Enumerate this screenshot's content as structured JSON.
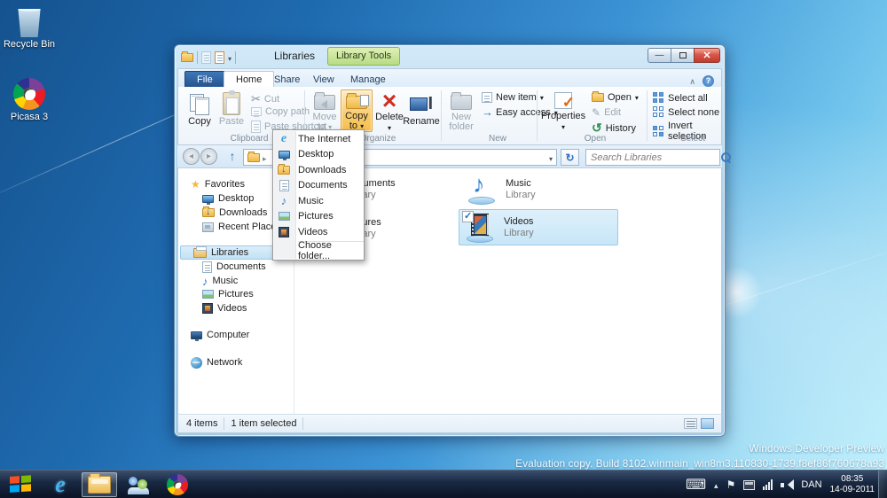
{
  "desktop": {
    "icons": {
      "recycle_bin": "Recycle Bin",
      "picasa": "Picasa 3"
    },
    "watermark_line1": "Windows Developer Preview",
    "watermark_line2": "Evaluation copy. Build 8102.winmain_win8m3.110830-1739.f8ef86f760678a93"
  },
  "window": {
    "title": "Libraries",
    "tools_group": "Library Tools",
    "tabs": {
      "file": "File",
      "home": "Home",
      "share": "Share",
      "view": "View",
      "manage": "Manage"
    }
  },
  "ribbon": {
    "clipboard": {
      "group": "Clipboard",
      "copy": "Copy",
      "paste": "Paste",
      "cut": "Cut",
      "copy_path": "Copy path",
      "paste_shortcut": "Paste shortcut"
    },
    "organize": {
      "group": "Organize",
      "move_line1": "Move",
      "move_line2": "to",
      "copy_line1": "Copy",
      "copy_line2": "to",
      "delete": "Delete",
      "rename": "Rename"
    },
    "new": {
      "group": "New",
      "new_folder_line1": "New",
      "new_folder_line2": "folder",
      "new_item": "New item",
      "easy_access": "Easy access"
    },
    "open": {
      "group": "Open",
      "properties": "Properties",
      "open": "Open",
      "edit": "Edit",
      "history": "History"
    },
    "select": {
      "group": "Select",
      "select_all": "Select all",
      "select_none": "Select none",
      "invert": "Invert selection"
    }
  },
  "address": {
    "search_placeholder": "Search Libraries"
  },
  "menu": {
    "items": [
      "The Internet",
      "Desktop",
      "Downloads",
      "Documents",
      "Music",
      "Pictures",
      "Videos"
    ],
    "choose": "Choose folder..."
  },
  "nav": {
    "favorites": "Favorites",
    "fav_children": [
      "Desktop",
      "Downloads",
      "Recent Places"
    ],
    "libraries": "Libraries",
    "lib_children": [
      "Documents",
      "Music",
      "Pictures",
      "Videos"
    ],
    "computer": "Computer",
    "network": "Network"
  },
  "content": {
    "tiles": [
      {
        "name": "Documents",
        "sub": "Library"
      },
      {
        "name": "Music",
        "sub": "Library"
      },
      {
        "name": "Pictures",
        "sub": "Library"
      },
      {
        "name": "Videos",
        "sub": "Library"
      }
    ]
  },
  "status": {
    "count": "4 items",
    "selected": "1 item selected"
  },
  "taskbar": {
    "lang": "DAN",
    "time": "08:35",
    "date": "14-09-2011"
  },
  "colors": {
    "copy_to_highlight": "#f6c14f",
    "tools_green": "#b7dc83",
    "selection_blue": "#c8e6f8",
    "taskbar_dark": "#0c1628"
  }
}
